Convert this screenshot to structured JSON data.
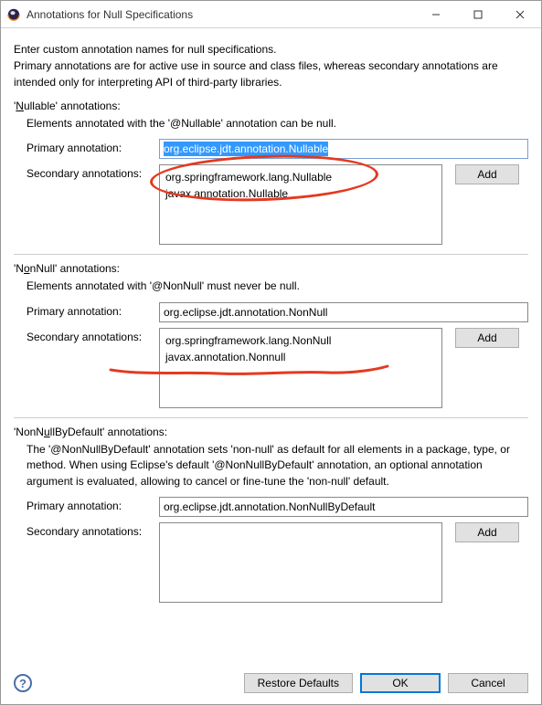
{
  "window": {
    "title": "Annotations for Null Specifications"
  },
  "intro": "Enter custom annotation names for null specifications.\nPrimary annotations are for active use in source and class files, whereas secondary annotations are intended only for interpreting API of third-party libraries.",
  "labels": {
    "primary": "Primary annotation:",
    "secondary": "Secondary annotations:",
    "add": "Add"
  },
  "nullable": {
    "title_prefix": "'",
    "title_underlined": "N",
    "title_rest": "ullable' annotations:",
    "desc": "Elements annotated with the '@Nullable' annotation can be null.",
    "primary": "org.eclipse.jdt.annotation.Nullable",
    "secondary": [
      "org.springframework.lang.Nullable",
      "javax.annotation.Nullable"
    ]
  },
  "nonnull": {
    "title_prefix": "'N",
    "title_underlined": "o",
    "title_rest": "nNull' annotations:",
    "desc": "Elements annotated with '@NonNull' must never be null.",
    "primary": "org.eclipse.jdt.annotation.NonNull",
    "secondary": [
      "org.springframework.lang.NonNull",
      "javax.annotation.Nonnull"
    ]
  },
  "nonnulldefault": {
    "title_prefix": "'NonN",
    "title_underlined": "u",
    "title_rest": "llByDefault' annotations:",
    "desc": "The '@NonNullByDefault' annotation sets 'non-null' as default for all elements in a package, type, or method. When using Eclipse's default '@NonNullByDefault' annotation, an optional annotation argument is evaluated, allowing to cancel or fine-tune the 'non-null' default.",
    "primary": "org.eclipse.jdt.annotation.NonNullByDefault",
    "secondary": []
  },
  "footer": {
    "restore": "Restore Defaults",
    "ok": "OK",
    "cancel": "Cancel"
  }
}
